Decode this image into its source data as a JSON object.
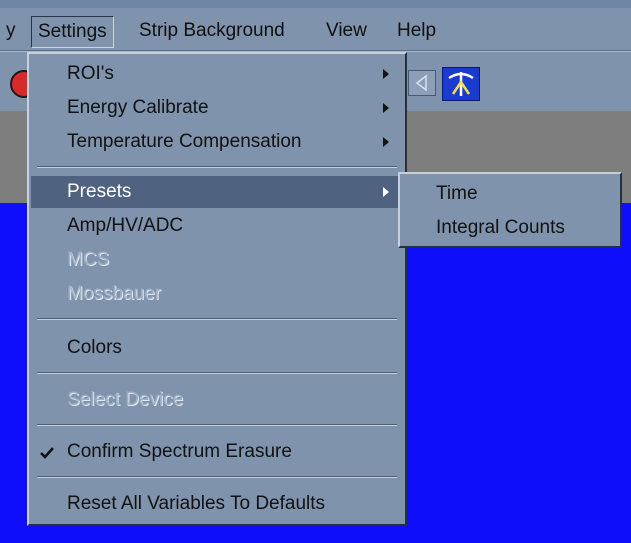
{
  "menubar": {
    "items": [
      {
        "label": "y"
      },
      {
        "label": "Settings",
        "open": true
      },
      {
        "label": "Strip Background"
      },
      {
        "label": "View"
      },
      {
        "label": "Help"
      }
    ]
  },
  "settings_menu": {
    "items": [
      {
        "label": "ROI's",
        "submenu": true,
        "enabled": true
      },
      {
        "label": "Energy Calibrate",
        "submenu": true,
        "enabled": true
      },
      {
        "label": "Temperature Compensation",
        "submenu": true,
        "enabled": true
      },
      {
        "label": "Presets",
        "submenu": true,
        "enabled": true,
        "highlighted": true
      },
      {
        "label": "Amp/HV/ADC",
        "enabled": true
      },
      {
        "label": "MCS",
        "enabled": false
      },
      {
        "label": "Mossbauer",
        "enabled": false
      },
      {
        "label": "Colors",
        "enabled": true
      },
      {
        "label": "Select Device",
        "enabled": false
      },
      {
        "label": "Confirm Spectrum Erasure",
        "enabled": true,
        "checked": true
      },
      {
        "label": "Reset All Variables To Defaults",
        "enabled": true
      }
    ]
  },
  "presets_submenu": {
    "items": [
      {
        "label": "Time"
      },
      {
        "label": "Integral Counts"
      }
    ]
  },
  "toolbar": {
    "icons": [
      "stop-icon",
      "triangle-left-icon",
      "app-logo-icon"
    ]
  },
  "colors": {
    "menu_bg": "#7f93ad",
    "highlight": "#4f627f",
    "spectrum_bg": "#0e0efa",
    "gray_band": "#7e7e7e"
  }
}
